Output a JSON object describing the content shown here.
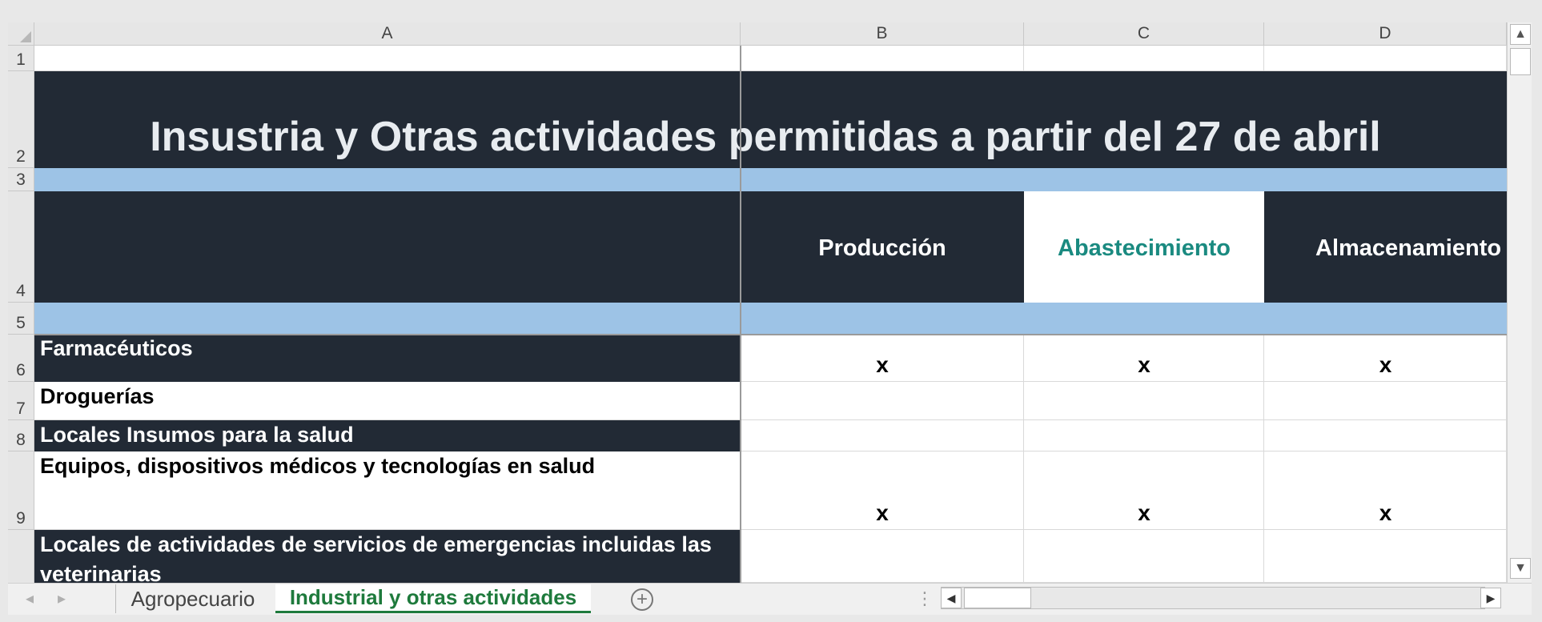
{
  "columns": [
    "A",
    "B",
    "C",
    "D"
  ],
  "rows": [
    "1",
    "2",
    "3",
    "4",
    "5",
    "6",
    "7",
    "8",
    "9"
  ],
  "title": "Insustria y Otras actividades permitidas a partir del 27 de abril",
  "headers": {
    "b": "Producción",
    "c": "Abastecimiento",
    "d": "Almacenamiento"
  },
  "items": [
    {
      "label": "Farmacéuticos",
      "b": "x",
      "c": "x",
      "d": "x"
    },
    {
      "label": "Droguerías",
      "b": "",
      "c": "",
      "d": ""
    },
    {
      "label": "Locales Insumos para la salud",
      "b": "",
      "c": "",
      "d": ""
    },
    {
      "label": "Equipos, dispositivos médicos y tecnologías en salud",
      "b": "x",
      "c": "x",
      "d": "x"
    },
    {
      "label": "Locales de actividades de servicios de emergencias incluidas las",
      "label2": "veterinarias"
    }
  ],
  "tabs": {
    "sheet1": "Agropecuario",
    "sheet2": "Industrial y otras actividades"
  },
  "colors": {
    "dark": "#222a35",
    "band": "#9dc3e6",
    "accent": "#1a8a80",
    "tab_active": "#1e7a3c"
  }
}
